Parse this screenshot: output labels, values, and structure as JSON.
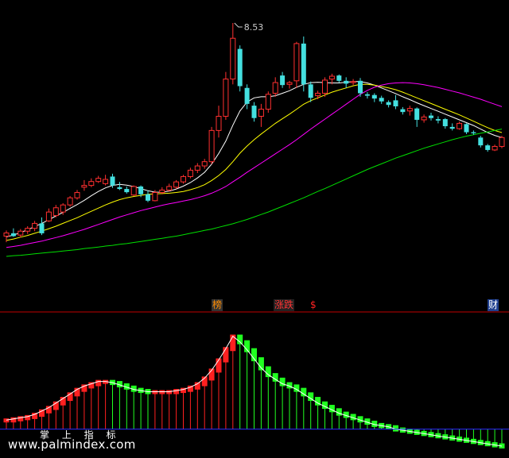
{
  "chart_data": {
    "type": "candlestick",
    "title": "",
    "peak_label": "8.53",
    "candles": [
      {
        "o": 2.52,
        "h": 2.68,
        "l": 2.35,
        "c": 2.61,
        "up": true
      },
      {
        "o": 2.6,
        "h": 2.74,
        "l": 2.5,
        "c": 2.52,
        "up": false
      },
      {
        "o": 2.55,
        "h": 2.72,
        "l": 2.48,
        "c": 2.66,
        "up": true
      },
      {
        "o": 2.66,
        "h": 2.8,
        "l": 2.58,
        "c": 2.74,
        "up": true
      },
      {
        "o": 2.74,
        "h": 2.95,
        "l": 2.66,
        "c": 2.88,
        "up": true
      },
      {
        "o": 2.88,
        "h": 3.05,
        "l": 2.55,
        "c": 2.6,
        "up": false
      },
      {
        "o": 2.95,
        "h": 3.3,
        "l": 2.92,
        "c": 3.2,
        "up": true
      },
      {
        "o": 3.1,
        "h": 3.4,
        "l": 3.05,
        "c": 3.32,
        "up": true
      },
      {
        "o": 3.2,
        "h": 3.45,
        "l": 3.12,
        "c": 3.4,
        "up": true
      },
      {
        "o": 3.4,
        "h": 3.65,
        "l": 3.35,
        "c": 3.6,
        "up": true
      },
      {
        "o": 3.6,
        "h": 3.82,
        "l": 3.55,
        "c": 3.75,
        "up": true
      },
      {
        "o": 3.9,
        "h": 4.1,
        "l": 3.8,
        "c": 3.95,
        "up": true
      },
      {
        "o": 3.95,
        "h": 4.15,
        "l": 3.9,
        "c": 4.06,
        "up": true
      },
      {
        "o": 4.06,
        "h": 4.22,
        "l": 4.02,
        "c": 4.15,
        "up": true
      },
      {
        "o": 4.0,
        "h": 4.25,
        "l": 3.95,
        "c": 4.12,
        "up": true
      },
      {
        "o": 4.2,
        "h": 4.28,
        "l": 3.88,
        "c": 3.95,
        "up": false
      },
      {
        "o": 3.9,
        "h": 4.05,
        "l": 3.82,
        "c": 3.85,
        "up": false
      },
      {
        "o": 3.85,
        "h": 3.92,
        "l": 3.72,
        "c": 3.76,
        "up": false
      },
      {
        "o": 3.68,
        "h": 3.95,
        "l": 3.65,
        "c": 3.92,
        "up": true
      },
      {
        "o": 3.92,
        "h": 3.95,
        "l": 3.62,
        "c": 3.7,
        "up": false
      },
      {
        "o": 3.7,
        "h": 3.8,
        "l": 3.48,
        "c": 3.52,
        "up": false
      },
      {
        "o": 3.52,
        "h": 3.82,
        "l": 3.5,
        "c": 3.75,
        "up": true
      },
      {
        "o": 3.75,
        "h": 3.9,
        "l": 3.7,
        "c": 3.82,
        "up": true
      },
      {
        "o": 3.82,
        "h": 4.0,
        "l": 3.78,
        "c": 3.92,
        "up": true
      },
      {
        "o": 3.9,
        "h": 4.1,
        "l": 3.85,
        "c": 4.05,
        "up": true
      },
      {
        "o": 4.05,
        "h": 4.25,
        "l": 4.0,
        "c": 4.2,
        "up": true
      },
      {
        "o": 4.2,
        "h": 4.45,
        "l": 4.15,
        "c": 4.38,
        "up": true
      },
      {
        "o": 4.38,
        "h": 4.58,
        "l": 4.3,
        "c": 4.5,
        "up": true
      },
      {
        "o": 4.5,
        "h": 4.7,
        "l": 4.42,
        "c": 4.62,
        "up": true
      },
      {
        "o": 4.62,
        "h": 5.6,
        "l": 4.55,
        "c": 5.5,
        "up": true
      },
      {
        "o": 5.5,
        "h": 6.2,
        "l": 5.3,
        "c": 5.9,
        "up": true
      },
      {
        "o": 5.9,
        "h": 7.15,
        "l": 5.8,
        "c": 6.95,
        "up": true
      },
      {
        "o": 6.95,
        "h": 8.53,
        "l": 6.8,
        "c": 8.1,
        "up": true
      },
      {
        "o": 7.8,
        "h": 7.9,
        "l": 6.6,
        "c": 6.75,
        "up": false
      },
      {
        "o": 6.7,
        "h": 6.8,
        "l": 6.1,
        "c": 6.25,
        "up": false
      },
      {
        "o": 6.2,
        "h": 6.3,
        "l": 5.75,
        "c": 5.85,
        "up": false
      },
      {
        "o": 5.9,
        "h": 6.25,
        "l": 5.6,
        "c": 6.1,
        "up": true
      },
      {
        "o": 6.1,
        "h": 6.6,
        "l": 6.0,
        "c": 6.52,
        "up": true
      },
      {
        "o": 6.55,
        "h": 7.0,
        "l": 6.45,
        "c": 6.85,
        "up": true
      },
      {
        "o": 7.05,
        "h": 7.15,
        "l": 6.7,
        "c": 6.78,
        "up": false
      },
      {
        "o": 6.8,
        "h": 6.9,
        "l": 6.68,
        "c": 6.85,
        "up": true
      },
      {
        "o": 6.9,
        "h": 8.0,
        "l": 6.7,
        "c": 7.95,
        "up": true
      },
      {
        "o": 7.95,
        "h": 8.15,
        "l": 6.6,
        "c": 6.8,
        "up": false
      },
      {
        "o": 6.8,
        "h": 6.88,
        "l": 6.3,
        "c": 6.42,
        "up": false
      },
      {
        "o": 6.48,
        "h": 6.62,
        "l": 6.38,
        "c": 6.55,
        "up": true
      },
      {
        "o": 6.55,
        "h": 7.0,
        "l": 6.45,
        "c": 6.92,
        "up": true
      },
      {
        "o": 6.95,
        "h": 7.1,
        "l": 6.8,
        "c": 7.03,
        "up": true
      },
      {
        "o": 7.05,
        "h": 7.08,
        "l": 6.85,
        "c": 6.9,
        "up": false
      },
      {
        "o": 6.9,
        "h": 7.0,
        "l": 6.7,
        "c": 6.82,
        "up": false
      },
      {
        "o": 6.85,
        "h": 6.95,
        "l": 6.78,
        "c": 6.88,
        "up": true
      },
      {
        "o": 6.9,
        "h": 6.98,
        "l": 6.45,
        "c": 6.55,
        "up": false
      },
      {
        "o": 6.52,
        "h": 6.58,
        "l": 6.4,
        "c": 6.48,
        "up": false
      },
      {
        "o": 6.5,
        "h": 6.55,
        "l": 6.3,
        "c": 6.4,
        "up": false
      },
      {
        "o": 6.42,
        "h": 6.48,
        "l": 6.25,
        "c": 6.32,
        "up": false
      },
      {
        "o": 6.3,
        "h": 6.35,
        "l": 6.15,
        "c": 6.22,
        "up": false
      },
      {
        "o": 6.35,
        "h": 6.5,
        "l": 6.1,
        "c": 6.18,
        "up": false
      },
      {
        "o": 6.1,
        "h": 6.16,
        "l": 5.95,
        "c": 6.02,
        "up": false
      },
      {
        "o": 6.05,
        "h": 6.2,
        "l": 5.92,
        "c": 6.12,
        "up": true
      },
      {
        "o": 6.12,
        "h": 6.15,
        "l": 5.6,
        "c": 5.8,
        "up": false
      },
      {
        "o": 5.8,
        "h": 5.95,
        "l": 5.72,
        "c": 5.88,
        "up": true
      },
      {
        "o": 5.92,
        "h": 6.0,
        "l": 5.78,
        "c": 5.85,
        "up": false
      },
      {
        "o": 5.82,
        "h": 5.9,
        "l": 5.7,
        "c": 5.78,
        "up": false
      },
      {
        "o": 5.82,
        "h": 5.85,
        "l": 5.55,
        "c": 5.62,
        "up": false
      },
      {
        "o": 5.6,
        "h": 5.7,
        "l": 5.5,
        "c": 5.55,
        "up": false
      },
      {
        "o": 5.55,
        "h": 5.75,
        "l": 5.52,
        "c": 5.7,
        "up": true
      },
      {
        "o": 5.68,
        "h": 5.7,
        "l": 5.4,
        "c": 5.45,
        "up": false
      },
      {
        "o": 5.45,
        "h": 5.5,
        "l": 5.38,
        "c": 5.42,
        "up": false
      },
      {
        "o": 5.3,
        "h": 5.35,
        "l": 5.02,
        "c": 5.08,
        "up": false
      },
      {
        "o": 5.08,
        "h": 5.12,
        "l": 4.9,
        "c": 4.95,
        "up": false
      },
      {
        "o": 4.95,
        "h": 5.1,
        "l": 4.92,
        "c": 5.05,
        "up": true
      },
      {
        "o": 5.05,
        "h": 5.35,
        "l": 5.0,
        "c": 5.3,
        "up": true
      }
    ],
    "ma_lines": [
      {
        "color": "#ffffff",
        "values": [
          2.5,
          2.55,
          2.62,
          2.7,
          2.79,
          2.88,
          2.98,
          3.09,
          3.19,
          3.3,
          3.41,
          3.53,
          3.66,
          3.78,
          3.88,
          3.95,
          3.98,
          3.96,
          3.92,
          3.86,
          3.8,
          3.76,
          3.76,
          3.79,
          3.85,
          3.93,
          4.03,
          4.16,
          4.32,
          4.55,
          4.85,
          5.2,
          5.65,
          6.05,
          6.3,
          6.42,
          6.45,
          6.45,
          6.48,
          6.55,
          6.62,
          6.72,
          6.8,
          6.85,
          6.86,
          6.85,
          6.84,
          6.84,
          6.86,
          6.88,
          6.88,
          6.84,
          6.78,
          6.7,
          6.62,
          6.54,
          6.45,
          6.37,
          6.28,
          6.2,
          6.12,
          6.04,
          5.96,
          5.88,
          5.8,
          5.72,
          5.64,
          5.54,
          5.44,
          5.36,
          5.3
        ]
      },
      {
        "color": "#ffff00",
        "values": [
          2.4,
          2.44,
          2.49,
          2.54,
          2.6,
          2.66,
          2.73,
          2.8,
          2.88,
          2.96,
          3.04,
          3.13,
          3.22,
          3.31,
          3.4,
          3.48,
          3.55,
          3.6,
          3.64,
          3.67,
          3.7,
          3.71,
          3.72,
          3.73,
          3.75,
          3.78,
          3.83,
          3.89,
          3.97,
          4.09,
          4.23,
          4.4,
          4.62,
          4.86,
          5.06,
          5.24,
          5.4,
          5.55,
          5.7,
          5.83,
          5.96,
          6.1,
          6.24,
          6.34,
          6.42,
          6.5,
          6.58,
          6.64,
          6.7,
          6.76,
          6.8,
          6.8,
          6.78,
          6.74,
          6.7,
          6.65,
          6.58,
          6.5,
          6.42,
          6.34,
          6.26,
          6.18,
          6.1,
          6.02,
          5.94,
          5.85,
          5.76,
          5.67,
          5.58,
          5.5,
          5.44
        ]
      },
      {
        "color": "#ff00ff",
        "values": [
          2.2,
          2.23,
          2.26,
          2.3,
          2.34,
          2.38,
          2.43,
          2.48,
          2.53,
          2.59,
          2.65,
          2.71,
          2.78,
          2.85,
          2.92,
          2.99,
          3.06,
          3.12,
          3.18,
          3.24,
          3.29,
          3.34,
          3.39,
          3.43,
          3.47,
          3.51,
          3.55,
          3.6,
          3.66,
          3.73,
          3.82,
          3.92,
          4.05,
          4.18,
          4.32,
          4.45,
          4.58,
          4.71,
          4.84,
          4.97,
          5.1,
          5.24,
          5.39,
          5.54,
          5.68,
          5.82,
          5.96,
          6.1,
          6.24,
          6.38,
          6.52,
          6.63,
          6.72,
          6.78,
          6.82,
          6.84,
          6.85,
          6.84,
          6.82,
          6.79,
          6.75,
          6.71,
          6.66,
          6.61,
          6.56,
          6.5,
          6.44,
          6.38,
          6.31,
          6.24,
          6.17
        ]
      },
      {
        "color": "#00e000",
        "values": [
          1.95,
          1.97,
          1.98,
          2.0,
          2.02,
          2.04,
          2.06,
          2.08,
          2.1,
          2.12,
          2.14,
          2.17,
          2.19,
          2.21,
          2.24,
          2.26,
          2.29,
          2.31,
          2.34,
          2.37,
          2.4,
          2.43,
          2.46,
          2.49,
          2.52,
          2.56,
          2.6,
          2.64,
          2.68,
          2.72,
          2.77,
          2.82,
          2.87,
          2.93,
          2.99,
          3.06,
          3.13,
          3.2,
          3.28,
          3.36,
          3.44,
          3.52,
          3.6,
          3.69,
          3.78,
          3.86,
          3.95,
          4.04,
          4.13,
          4.22,
          4.31,
          4.4,
          4.48,
          4.56,
          4.64,
          4.72,
          4.79,
          4.86,
          4.93,
          5.0,
          5.06,
          5.12,
          5.18,
          5.24,
          5.29,
          5.34,
          5.38,
          5.42,
          5.46,
          5.5,
          5.54
        ]
      }
    ],
    "ylim": [
      1.3,
      9.0
    ],
    "tags": [
      {
        "text": "榜",
        "color": "#ff8c00",
        "bg": "#333",
        "pos": 0.428
      },
      {
        "text": "涨跌",
        "color": "#ff3333",
        "bg": "#222",
        "pos": 0.55
      },
      {
        "text": "$",
        "color": "#ff2222",
        "bg": "#000",
        "pos": 0.62
      },
      {
        "text": "财",
        "color": "#ffffff",
        "bg": "#1f3f8f",
        "pos": 0.97
      }
    ],
    "indicator": {
      "name": "掌 上 指 标",
      "values": [
        0.08,
        0.09,
        0.1,
        0.11,
        0.13,
        0.16,
        0.19,
        0.23,
        0.27,
        0.31,
        0.35,
        0.38,
        0.4,
        0.42,
        0.42,
        0.41,
        0.39,
        0.37,
        0.35,
        0.34,
        0.33,
        0.33,
        0.33,
        0.33,
        0.34,
        0.35,
        0.37,
        0.4,
        0.45,
        0.52,
        0.61,
        0.71,
        0.82,
        0.77,
        0.7,
        0.62,
        0.54,
        0.48,
        0.44,
        0.4,
        0.38,
        0.35,
        0.31,
        0.27,
        0.23,
        0.2,
        0.17,
        0.14,
        0.12,
        0.1,
        0.08,
        0.06,
        0.04,
        0.03,
        0.02,
        0.0,
        -0.01,
        -0.02,
        -0.03,
        -0.04,
        -0.05,
        -0.06,
        -0.07,
        -0.08,
        -0.09,
        -0.1,
        -0.11,
        -0.12,
        -0.13,
        -0.14,
        -0.15
      ],
      "ylim": [
        -0.22,
        0.95
      ]
    },
    "watermark": "www.palmindex.com",
    "colors": {
      "up": "#ff3030",
      "down": "#44e0e0",
      "hist_up": "#ff2020",
      "hist_down": "#20ff20",
      "zero_line": "#2b2bff",
      "sep": "#c00000"
    }
  }
}
